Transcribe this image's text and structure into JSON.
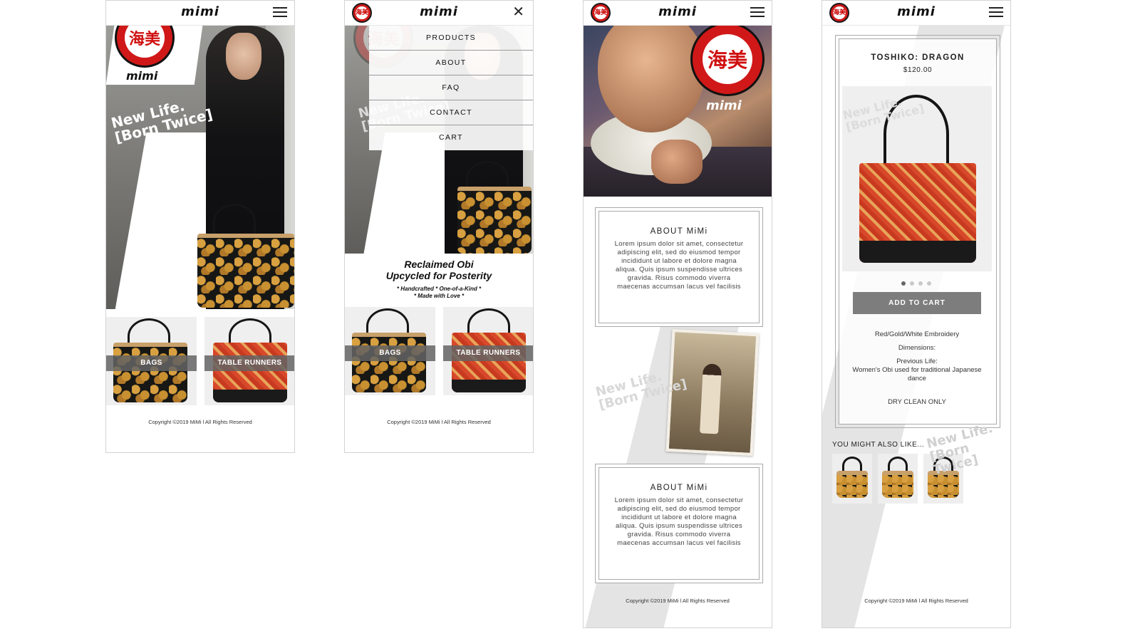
{
  "brand": {
    "name": "mimi",
    "logo_text": "海美",
    "wordmark": "mimi"
  },
  "common": {
    "copyright": "Copyright ©2019 MiMi l All Rights Reserved",
    "hero_tag_line1": "New Life.",
    "hero_tag_line2": "[Born Twice]"
  },
  "categories": [
    {
      "label": "BAGS"
    },
    {
      "label": "TABLE RUNNERS"
    }
  ],
  "nav": {
    "items": [
      {
        "label": "PRODUCTS"
      },
      {
        "label": "ABOUT"
      },
      {
        "label": "FAQ"
      },
      {
        "label": "CONTACT"
      },
      {
        "label": "CART"
      }
    ]
  },
  "home2": {
    "tagline_1": "Reclaimed Obi",
    "tagline_2": "Upcycled for Posterity",
    "tagline_3": "* Handcrafted * One-of-a-Kind *",
    "tagline_4": "* Made with Love *"
  },
  "about": {
    "title": "ABOUT MiMi",
    "body": "Lorem ipsum dolor sit amet, consectetur adipiscing elit, sed do eiusmod tempor incididunt ut labore et dolore magna aliqua. Quis ipsum suspendisse ultrices gravida. Risus commodo viverra maecenas accumsan lacus vel facilisis"
  },
  "product": {
    "title": "TOSHIKO: DRAGON",
    "price": "$120.00",
    "carousel": {
      "count": 4,
      "active": 1
    },
    "add_to_cart": "ADD TO CART",
    "color": "Red/Gold/White Embroidery",
    "dimensions_label": "Dimensions:",
    "previous_life_label": "Previous Life:",
    "previous_life_text": "Women's Obi used for traditional Japanese dance",
    "care": "DRY CLEAN ONLY",
    "also_like": "YOU MIGHT ALSO LIKE...",
    "related_count": 3
  },
  "colors": {
    "accent": "#d01818",
    "button": "#7d7d7d"
  }
}
